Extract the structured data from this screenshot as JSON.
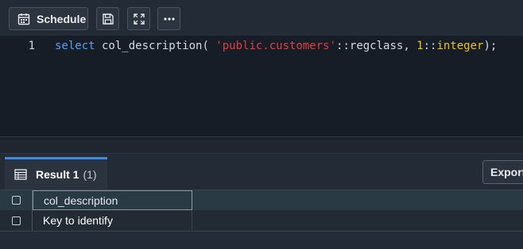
{
  "toolbar": {
    "schedule_label": "Schedule",
    "icons": {
      "schedule": "calendar-icon",
      "save": "save-icon",
      "expand": "expand-icon",
      "more": "ellipsis-icon"
    }
  },
  "editor": {
    "line_number": "1",
    "tokens": {
      "kw": "select",
      "fn": " col_description(",
      "str": " 'public.customers'",
      "op1": "::regclass,",
      "num": " 1",
      "op2": "::",
      "type": "integer",
      "end": ");"
    }
  },
  "results": {
    "tab_label": "Result 1",
    "tab_count": "(1)",
    "export_label": "Export",
    "columns": [
      "col_description"
    ],
    "rows": [
      [
        "Key to identify"
      ]
    ]
  },
  "colors": {
    "accent": "#3f8ae0",
    "keyword": "#5aa0f0",
    "string": "#e03e3e",
    "number": "#f0c020"
  }
}
